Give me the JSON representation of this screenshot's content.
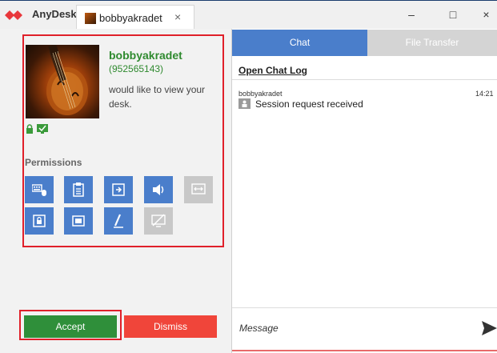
{
  "titlebar": {
    "app_name": "AnyDesk",
    "tab_label": "bobbyakradet",
    "tab_close": "×",
    "minimize": "–",
    "maximize": "□",
    "close": "×",
    "brand_color": "#e8373b"
  },
  "request": {
    "user_name": "bobbyakradet",
    "user_id": "(952565143)",
    "message": "would like to view your desk."
  },
  "permissions": {
    "label": "Permissions",
    "items": [
      {
        "icon": "keyboard-mouse-icon",
        "enabled": true
      },
      {
        "icon": "clipboard-icon",
        "enabled": true
      },
      {
        "icon": "file-manager-icon",
        "enabled": true
      },
      {
        "icon": "speaker-icon",
        "enabled": true
      },
      {
        "icon": "control-switch-icon",
        "enabled": false
      },
      {
        "icon": "lock-desk-icon",
        "enabled": true
      },
      {
        "icon": "record-session-icon",
        "enabled": true
      },
      {
        "icon": "draw-icon",
        "enabled": true
      },
      {
        "icon": "privacy-mode-icon",
        "enabled": false
      }
    ]
  },
  "actions": {
    "accept_label": "Accept",
    "dismiss_label": "Dismiss",
    "accept_color": "#2f8f3a",
    "dismiss_color": "#f0453a"
  },
  "chat": {
    "tabs": [
      {
        "label": "Chat",
        "active": true
      },
      {
        "label": "File Transfer",
        "active": false
      }
    ],
    "open_log_label": "Open Chat Log",
    "messages": [
      {
        "sender": "bobbyakradet",
        "time": "14:21",
        "text": "Session request received"
      }
    ],
    "input_placeholder": "Message"
  }
}
